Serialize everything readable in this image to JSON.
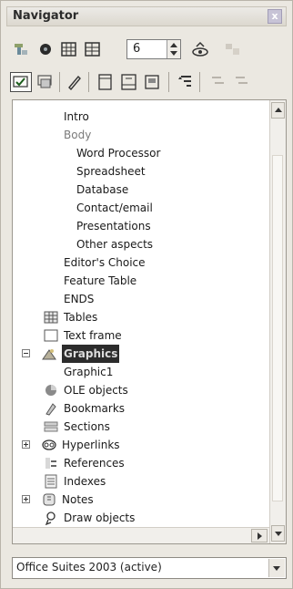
{
  "window": {
    "title": "Navigator",
    "close_glyph": "x"
  },
  "toolbar": {
    "row1": [
      {
        "name": "navigation-toggle-icon",
        "icon": "navigator-toggle"
      },
      {
        "name": "navigation-icon",
        "icon": "circle"
      },
      {
        "name": "previous-icon",
        "icon": "grid-prev"
      },
      {
        "name": "next-icon",
        "icon": "grid-next"
      },
      {
        "name": "drag-mode-icon",
        "icon": "drag-mode"
      },
      {
        "name": "disabled-icon",
        "icon": "disabled"
      }
    ],
    "row2": [
      {
        "name": "content-view-icon",
        "icon": "content-view"
      },
      {
        "name": "set-reminder-icon",
        "icon": "reminder"
      },
      {
        "name": "edit-icon",
        "icon": "pencil"
      },
      {
        "name": "header-icon",
        "icon": "header"
      },
      {
        "name": "footer-icon",
        "icon": "footer"
      },
      {
        "name": "anchor-icon",
        "icon": "anchor"
      },
      {
        "name": "heading-levels-icon",
        "icon": "levels"
      },
      {
        "name": "promote-icon",
        "icon": "promote"
      },
      {
        "name": "demote-icon",
        "icon": "demote"
      }
    ],
    "page_number": "6"
  },
  "tree": {
    "items": [
      {
        "label": "Intro",
        "level": 1
      },
      {
        "label": "Body",
        "level": 1,
        "muted": true
      },
      {
        "label": "Word Processor",
        "level": 2
      },
      {
        "label": "Spreadsheet",
        "level": 2
      },
      {
        "label": "Database",
        "level": 2
      },
      {
        "label": "Contact/email",
        "level": 2
      },
      {
        "label": "Presentations",
        "level": 2
      },
      {
        "label": "Other aspects",
        "level": 2
      },
      {
        "label": "Editor's Choice",
        "level": 1
      },
      {
        "label": "Feature Table",
        "level": 1
      },
      {
        "label": "ENDS",
        "level": 1
      },
      {
        "label": "Tables",
        "icon": "table-icon"
      },
      {
        "label": "Text frame",
        "icon": "text-frame-icon"
      },
      {
        "label": "Graphics",
        "icon": "graphics-icon",
        "expanded": true,
        "selected": true
      },
      {
        "label": "Graphic1",
        "level": 1
      },
      {
        "label": "OLE objects",
        "icon": "ole-icon"
      },
      {
        "label": "Bookmarks",
        "icon": "bookmark-icon"
      },
      {
        "label": "Sections",
        "icon": "sections-icon"
      },
      {
        "label": "Hyperlinks",
        "icon": "hyperlink-icon",
        "expander": "plus"
      },
      {
        "label": "References",
        "icon": "references-icon"
      },
      {
        "label": "Indexes",
        "icon": "indexes-icon"
      },
      {
        "label": "Notes",
        "icon": "notes-icon",
        "expander": "plus"
      },
      {
        "label": "Draw objects",
        "icon": "draw-objects-icon"
      }
    ]
  },
  "document_select": {
    "value": "Office Suites 2003 (active)"
  },
  "colors": {
    "accent": "#2c2c2c",
    "background": "#ebe8e1",
    "panel": "#ffffff"
  }
}
